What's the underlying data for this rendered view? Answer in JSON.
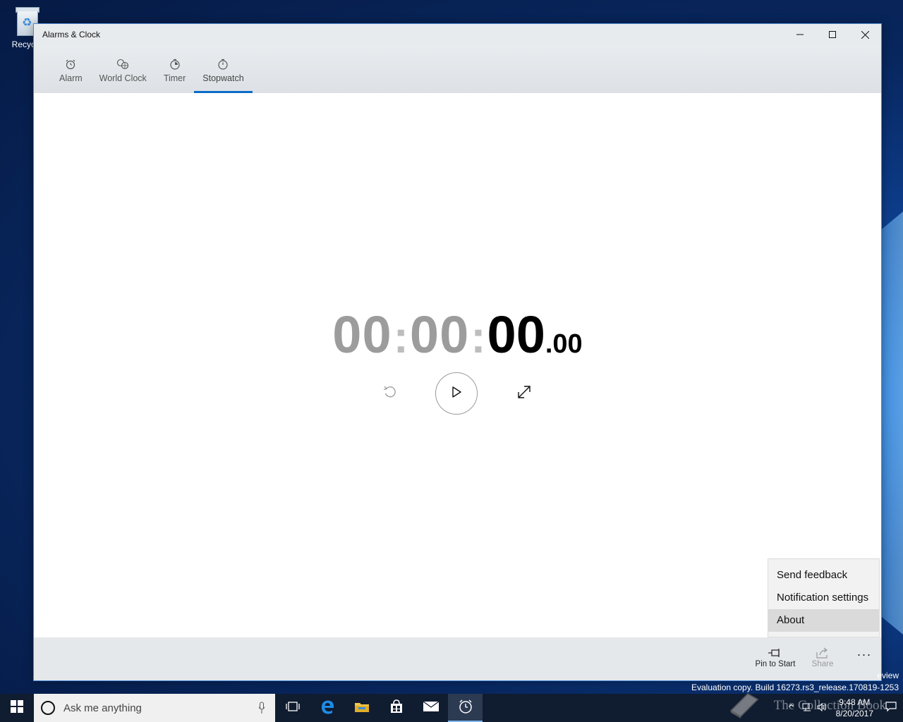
{
  "desktop": {
    "recycle_label": "Recycle"
  },
  "window": {
    "title": "Alarms & Clock"
  },
  "tabs": [
    {
      "label": "Alarm",
      "icon": "alarm-clock-icon"
    },
    {
      "label": "World Clock",
      "icon": "world-clock-icon"
    },
    {
      "label": "Timer",
      "icon": "timer-icon"
    },
    {
      "label": "Stopwatch",
      "icon": "stopwatch-icon",
      "active": true
    }
  ],
  "stopwatch": {
    "hours": "00",
    "minutes": "00",
    "seconds": "00",
    "fraction": ".00",
    "sep": ":"
  },
  "appbar": {
    "pin_label": "Pin to Start",
    "share_label": "Share",
    "more_label": "···"
  },
  "menu": {
    "items": [
      "Send feedback",
      "Notification settings",
      "About"
    ]
  },
  "watermark": {
    "line1": "eview",
    "line2": "Evaluation copy. Build 16273.rs3_release.170819-1253"
  },
  "taskbar": {
    "search_placeholder": "Ask me anything",
    "time": "9:48 AM",
    "date": "8/20/2017",
    "overlay_text": "The Collection Book"
  },
  "colors": {
    "accent": "#0a6cc8"
  }
}
